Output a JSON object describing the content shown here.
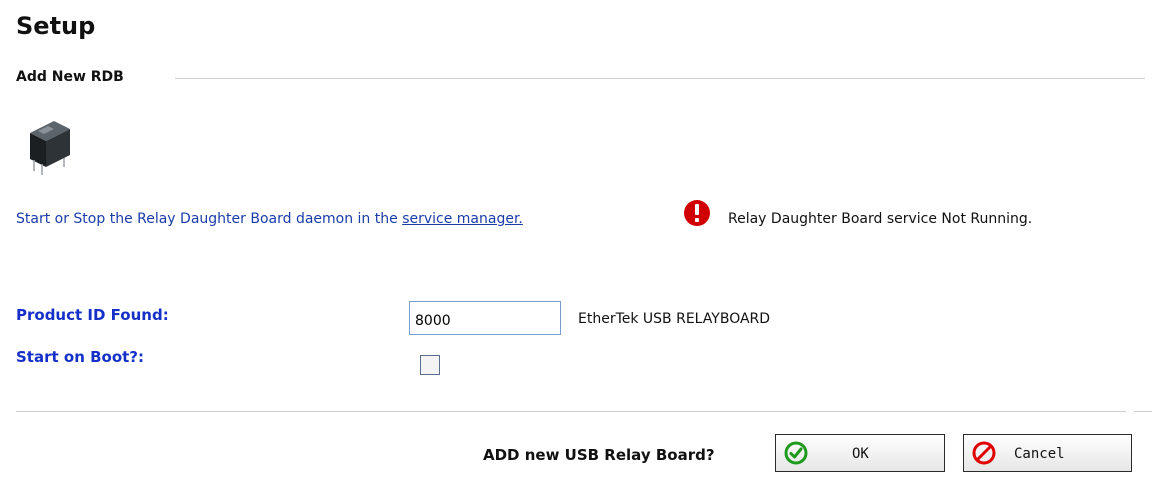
{
  "page": {
    "title": "Setup"
  },
  "section": {
    "title": "Add New RDB"
  },
  "service": {
    "message_prefix": "Start or Stop the Relay Daughter Board daemon in the ",
    "link_label": "service manager.",
    "status_text": "Relay Daughter Board service Not Running."
  },
  "form": {
    "product_id_label": "Product ID Found:",
    "product_id_value": "8000",
    "board_name": "EtherTek USB RELAYBOARD",
    "start_on_boot_label": "Start on Boot?:",
    "start_on_boot_checked": false
  },
  "actions": {
    "confirm_label": "ADD new USB Relay Board?",
    "ok_label": "OK",
    "cancel_label": "Cancel"
  },
  "icons": {
    "relay": "relay-board-icon",
    "alert": "alert-error-icon",
    "ok": "check-circle-icon",
    "cancel": "no-entry-icon"
  },
  "colors": {
    "link_blue": "#1a3caa",
    "label_blue": "#1530c9",
    "alert_red": "#d00000",
    "ok_green": "#1e9a1e",
    "cancel_red": "#e00000"
  }
}
